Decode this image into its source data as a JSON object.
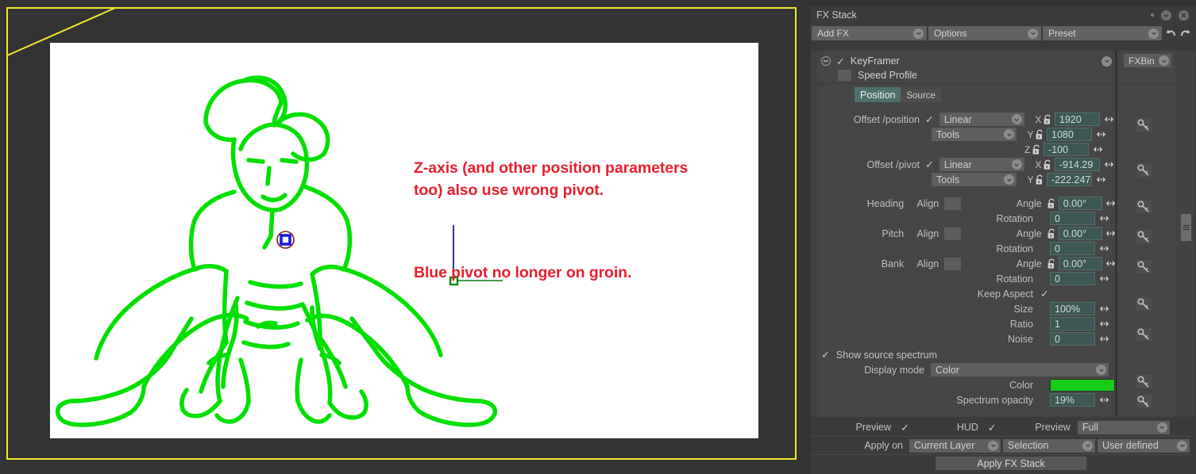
{
  "viewport": {
    "annotations": [
      "Z-axis (and other position parameters too) also use wrong pivot.",
      "Blue pivot no longer on groin."
    ],
    "annotation_color": "#e8202e",
    "frame_color": "#f2e829",
    "figure_stroke_color": "#00e000",
    "pivot_circle_color": "#7a1b20",
    "pivot_square_color": "#1a1ae0",
    "z_axis_color": "#1c1c9e",
    "gizmo_color": "#008000"
  },
  "panel": {
    "title": "FX Stack",
    "titlebar_icons": [
      "dot",
      "chevron-down-icon",
      "close-icon"
    ],
    "toolbar": {
      "add_fx": "Add FX",
      "options": "Options",
      "preset": "Preset",
      "undo": "undo-icon",
      "redo": "redo-icon"
    },
    "stack": {
      "effect_name": "KeyFramer",
      "effect_enabled": true,
      "speed_profile_label": "Speed Profile",
      "fx_bin_label": "FXBin",
      "tabs": [
        {
          "label": "Position",
          "active": true
        },
        {
          "label": "Source",
          "active": false
        }
      ],
      "groups": [
        {
          "name": "Offset /position",
          "checked": true,
          "interp": "Linear",
          "source": "Tools",
          "fields": [
            {
              "axis": "X",
              "locked": false,
              "value": "1920"
            },
            {
              "axis": "Y",
              "locked": false,
              "value": "1080"
            },
            {
              "axis": "Z",
              "locked": false,
              "value": "-100"
            }
          ]
        },
        {
          "name": "Offset /pivot",
          "checked": true,
          "interp": "Linear",
          "source": "Tools",
          "fields": [
            {
              "axis": "X",
              "locked": false,
              "value": "-914.29"
            },
            {
              "axis": "Y",
              "locked": false,
              "value": "-222.247"
            }
          ]
        }
      ],
      "rotations": [
        {
          "name": "Heading",
          "align_label": "Align",
          "angle_label": "Angle",
          "angle_value": "0.00°",
          "rotation_label": "Rotation",
          "rotation_value": "0"
        },
        {
          "name": "Pitch",
          "align_label": "Align",
          "angle_label": "Angle",
          "angle_value": "0.00°",
          "rotation_label": "Rotation",
          "rotation_value": "0"
        },
        {
          "name": "Bank",
          "align_label": "Align",
          "angle_label": "Angle",
          "angle_value": "0.00°",
          "rotation_label": "Rotation",
          "rotation_value": "0"
        }
      ],
      "scale": {
        "keep_aspect_label": "Keep Aspect",
        "keep_aspect_checked": true,
        "size_label": "Size",
        "size_value": "100%",
        "ratio_label": "Ratio",
        "ratio_value": "1",
        "noise_label": "Noise",
        "noise_value": "0"
      },
      "spectrum": {
        "show_label": "Show source spectrum",
        "show_checked": true,
        "display_mode_label": "Display mode",
        "display_mode_value": "Color",
        "color_label": "Color",
        "color_value": "#17cc17",
        "opacity_label": "Spectrum opacity",
        "opacity_value": "19%"
      }
    },
    "footer": {
      "preview_label": "Preview",
      "preview_checked": true,
      "hud_label": "HUD",
      "hud_checked": true,
      "preview2_label": "Preview",
      "preview2_value": "Full",
      "apply_on_label": "Apply on",
      "apply_on_value": "Current Layer",
      "selection_value": "Selection",
      "user_defined_value": "User defined",
      "apply_button": "Apply FX Stack"
    }
  }
}
